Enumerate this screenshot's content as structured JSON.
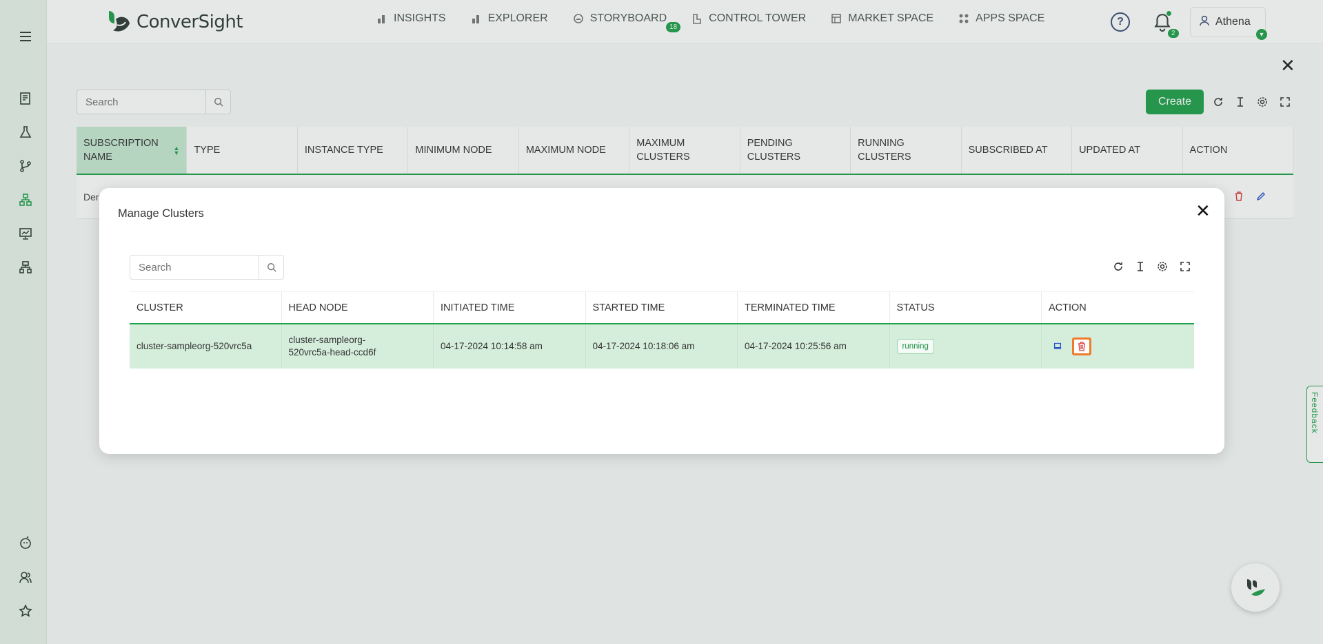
{
  "brand": {
    "name": "ConverSight"
  },
  "nav": {
    "items": [
      {
        "label": "INSIGHTS",
        "icon": "bar-chart-icon"
      },
      {
        "label": "EXPLORER",
        "icon": "bar-chart-icon"
      },
      {
        "label": "STORYBOARD",
        "icon": "storyboard-icon",
        "badge": "18"
      },
      {
        "label": "CONTROL TOWER",
        "icon": "tower-icon"
      },
      {
        "label": "MARKET SPACE",
        "icon": "market-icon"
      },
      {
        "label": "APPS SPACE",
        "icon": "apps-icon"
      }
    ]
  },
  "header": {
    "notification_count": "2",
    "user_name": "Athena"
  },
  "page": {
    "search_placeholder": "Search",
    "create_label": "Create",
    "columns": [
      "SUBSCRIPTION NAME",
      "TYPE",
      "INSTANCE TYPE",
      "MINIMUM NODE",
      "MAXIMUM NODE",
      "MAXIMUM CLUSTERS",
      "PENDING CLUSTERS",
      "RUNNING CLUSTERS",
      "SUBSCRIBED AT",
      "UPDATED AT",
      "ACTION"
    ],
    "row_partial": "Der"
  },
  "modal": {
    "title": "Manage Clusters",
    "search_placeholder": "Search",
    "columns": [
      "CLUSTER",
      "HEAD NODE",
      "INITIATED TIME",
      "STARTED TIME",
      "TERMINATED TIME",
      "STATUS",
      "ACTION"
    ],
    "rows": [
      {
        "cluster": "cluster-sampleorg-520vrc5a",
        "head_node_line1": "cluster-sampleorg-",
        "head_node_line2": "520vrc5a-head-ccd6f",
        "initiated": "04-17-2024 10:14:58 am",
        "started": "04-17-2024 10:18:06 am",
        "terminated": "04-17-2024 10:25:56 am",
        "status": "running"
      }
    ]
  },
  "feedback_label": "Feedback",
  "colors": {
    "accent": "#1fa04b",
    "highlight": "#f07a2a",
    "danger": "#d83b3b"
  }
}
